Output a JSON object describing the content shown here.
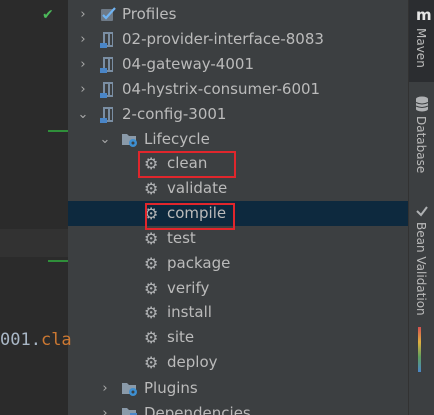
{
  "editor": {
    "code_number": "001.",
    "code_keyword": "cla"
  },
  "tree": {
    "rows": [
      {
        "label": "Profiles",
        "icon": "profiles-icon",
        "arrow": "chevron-right-icon"
      },
      {
        "label": "02-provider-interface-8083",
        "icon": "maven-module-icon",
        "arrow": "chevron-right-icon"
      },
      {
        "label": "04-gateway-4001",
        "icon": "maven-module-icon",
        "arrow": "chevron-right-icon"
      },
      {
        "label": "04-hystrix-consumer-6001",
        "icon": "maven-module-icon",
        "arrow": "chevron-right-icon"
      },
      {
        "label": "2-config-3001",
        "icon": "maven-module-icon",
        "arrow": "chevron-down-icon"
      },
      {
        "label": "Lifecycle",
        "icon": "lifecycle-folder-icon",
        "arrow": "chevron-down-icon"
      },
      {
        "label": "clean",
        "icon": "gear-icon"
      },
      {
        "label": "validate",
        "icon": "gear-icon"
      },
      {
        "label": "compile",
        "icon": "gear-icon"
      },
      {
        "label": "test",
        "icon": "gear-icon"
      },
      {
        "label": "package",
        "icon": "gear-icon"
      },
      {
        "label": "verify",
        "icon": "gear-icon"
      },
      {
        "label": "install",
        "icon": "gear-icon"
      },
      {
        "label": "site",
        "icon": "gear-icon"
      },
      {
        "label": "deploy",
        "icon": "gear-icon"
      },
      {
        "label": "Plugins",
        "icon": "plugins-folder-icon",
        "arrow": "chevron-right-icon"
      },
      {
        "label": "Dependencies",
        "icon": "dependencies-folder-icon",
        "arrow": "chevron-right-icon"
      }
    ]
  },
  "sidebar": {
    "maven": {
      "badge": "m",
      "label": "Maven"
    },
    "database": {
      "label": "Database"
    },
    "bean_validation": {
      "label": "Bean Validation"
    }
  },
  "colors": {
    "highlight_box": "#e0262c",
    "selected_row": "#0d293e",
    "check_mark": "#4cba5a"
  }
}
